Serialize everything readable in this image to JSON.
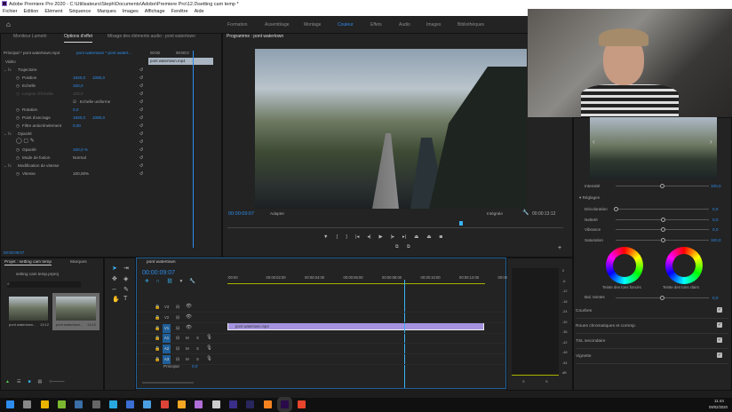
{
  "window": {
    "title": "Adobe Premiere Pro 2020 - C:\\Utilisateurs\\Steph\\Documents\\Adobe\\Premiere Pro\\12.0\\setting cam temp *"
  },
  "menu": [
    "Fichier",
    "Edition",
    "Elément",
    "Séquence",
    "Marques",
    "Images",
    "Affichage",
    "Fenêtre",
    "Aide"
  ],
  "workspaces": [
    "Formation",
    "Assemblage",
    "Montage",
    "Couleur",
    "Effets",
    "Audio",
    "Images",
    "Bibliothèques"
  ],
  "left_tabs": [
    "Moniteur Lumetri",
    "Options d'effet",
    "Mixage des éléments audio : pont watertown"
  ],
  "effect_controls": {
    "source": "Principal * pont watertown.mp4",
    "sequence": "pont watertown * pont watert...",
    "mini_time_start": "00:00",
    "mini_time_end": "00:00:0",
    "clip": "pont watertown.mp4",
    "video_label": "Vidéo",
    "rows": [
      {
        "label": "Trajectoire",
        "fx": true
      },
      {
        "label": "Position",
        "v1": "1920,0",
        "v2": "1080,0"
      },
      {
        "label": "Echelle",
        "v1": "100,0"
      },
      {
        "label": "Largeur d'échelle",
        "v1": "100,0",
        "disabled": true
      },
      {
        "label": "",
        "check": "Echelle uniforme"
      },
      {
        "label": "Rotation",
        "v1": "0,0"
      },
      {
        "label": "Point d'ancrage",
        "v1": "1920,0",
        "v2": "1080,0"
      },
      {
        "label": "Filtre anticrénelement",
        "v1": "0,00"
      },
      {
        "label": "Opacité",
        "fx": true
      },
      {
        "label": "",
        "masks": true
      },
      {
        "label": "Opacité",
        "v1": "100,0 %"
      },
      {
        "label": "Mode de fusion",
        "v1": "Normal"
      },
      {
        "label": "Modification de vitesse",
        "fx": true
      },
      {
        "label": "Vitesse",
        "v1": "100,00%"
      }
    ],
    "timecode": "00:00:09:07"
  },
  "program": {
    "tab": "Programme : pont watertown",
    "timecode": "00:00:09:07",
    "fit": "Adapter",
    "quality": "Intégrale",
    "duration": "00:00:13:12",
    "playhead_fraction": 0.69
  },
  "lumetri": {
    "intensity_label": "Intensité",
    "intensity_value": "100,0",
    "section": "Réglages",
    "sliders": [
      {
        "label": "Décoloration",
        "value": "0,0",
        "pos": 0
      },
      {
        "label": "Netteté",
        "value": "0,0",
        "pos": 0.5
      },
      {
        "label": "Vibrance",
        "value": "0,0",
        "pos": 0.5
      },
      {
        "label": "Saturation",
        "value": "100,0",
        "pos": 0.5
      }
    ],
    "wheel_dark": "Teinte des tons foncés",
    "wheel_light": "Teinte des tons clairs",
    "balance_label": "Bal. teintes",
    "balance_value": "0,0",
    "sections": [
      "Courbes",
      "Roues chromatiques et corresp.",
      "TSL secondaire",
      "Vignette"
    ]
  },
  "project": {
    "tabs": [
      "Projet : setting cam temp",
      "Marques"
    ],
    "file": "setting cam temp.prproj",
    "items": [
      {
        "name": "pont watertown...",
        "duration": "13:12"
      },
      {
        "name": "pont watertown...",
        "duration": "13:12"
      }
    ]
  },
  "timeline": {
    "tab": "pont watertown",
    "timecode": "00:00:09:07",
    "ticks": [
      ":00:00",
      "00:00:02:00",
      "00:00:04:00",
      "00:00:06:00",
      "00:00:08:00",
      "00:00:10:00",
      "00:00:12:00",
      "00:00"
    ],
    "video_tracks": [
      "V3",
      "V2",
      "V1"
    ],
    "audio_tracks": [
      "A1",
      "A2",
      "A3"
    ],
    "master_label": "Principal",
    "master_value": "0,0",
    "clip": "pont watertown.mp4",
    "playhead_fraction": 0.69
  },
  "meter": {
    "labels": [
      "0",
      "-6",
      "-12",
      "-18",
      "-24",
      "-30",
      "-36",
      "-42",
      "-48",
      "-54",
      "dB"
    ],
    "channels": [
      "S",
      "S"
    ]
  },
  "taskbar": {
    "time": "11:44",
    "date": "09/02/2020"
  },
  "colors": {
    "accent": "#2d8ceb",
    "clip": "#a593e0",
    "workarea": "#a8b400"
  }
}
